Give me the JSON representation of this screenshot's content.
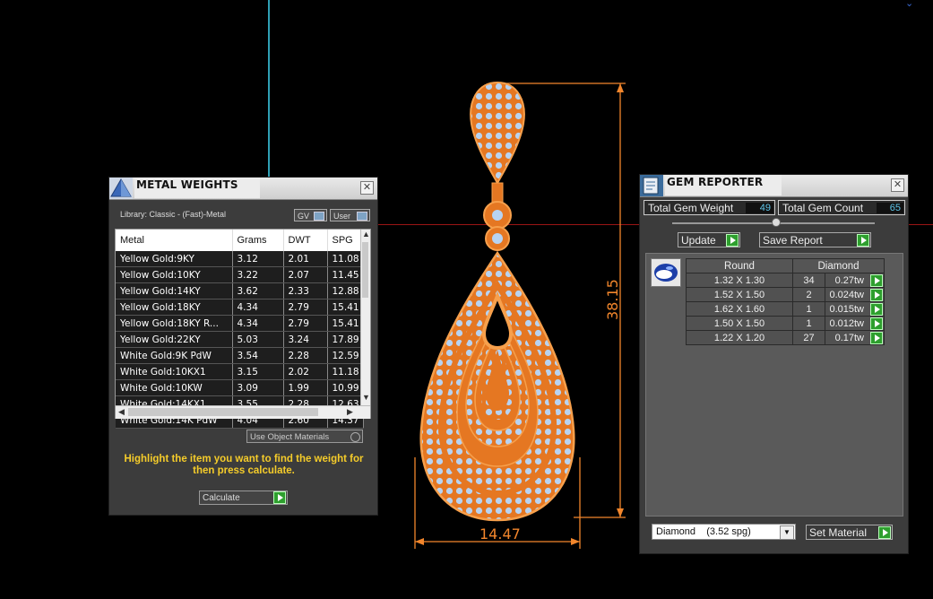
{
  "viewport": {
    "dim_height": "38.15",
    "dim_width": "14.47",
    "colors": {
      "accent_orange": "#f2862c",
      "gem_blue": "#b7d3f2",
      "guide_cyan": "#2f9fb4",
      "guide_red": "#9a1515"
    }
  },
  "metal_weights": {
    "title": "METAL WEIGHTS",
    "library": "Library: Classic - (Fast)-Metal",
    "gv_label": "GV",
    "user_label": "User",
    "columns": [
      "Metal",
      "Grams",
      "DWT",
      "SPG"
    ],
    "rows": [
      [
        "Yellow Gold:9KY",
        "3.12",
        "2.01",
        "11.08"
      ],
      [
        "Yellow Gold:10KY",
        "3.22",
        "2.07",
        "11.45"
      ],
      [
        "Yellow Gold:14KY",
        "3.62",
        "2.33",
        "12.88"
      ],
      [
        "Yellow Gold:18KY",
        "4.34",
        "2.79",
        "15.41"
      ],
      [
        "Yellow Gold:18KY R...",
        "4.34",
        "2.79",
        "15.41"
      ],
      [
        "Yellow Gold:22KY",
        "5.03",
        "3.24",
        "17.89"
      ],
      [
        "White Gold:9K PdW",
        "3.54",
        "2.28",
        "12.59"
      ],
      [
        "White Gold:10KX1",
        "3.15",
        "2.02",
        "11.18"
      ],
      [
        "White Gold:10KW",
        "3.09",
        "1.99",
        "10.99"
      ],
      [
        "White Gold:14KX1",
        "3.55",
        "2.28",
        "12.63"
      ],
      [
        "White Gold:14K PdW",
        "4.04",
        "2.60",
        "14.37"
      ]
    ],
    "use_object_materials": "Use Object Materials",
    "hint": "Highlight the item you want to find the weight for then press calculate.",
    "calculate": "Calculate"
  },
  "gem_reporter": {
    "title": "GEM REPORTER",
    "total_weight_label": "Total Gem Weight",
    "total_weight_value": "49",
    "total_count_label": "Total Gem Count",
    "total_count_value": "65",
    "update": "Update",
    "save_report": "Save Report",
    "col_shape": "Round",
    "col_material": "Diamond",
    "gems": [
      {
        "size": "1.32 X 1.30",
        "count": "34",
        "weight": "0.27tw"
      },
      {
        "size": "1.52 X 1.50",
        "count": "2",
        "weight": "0.024tw"
      },
      {
        "size": "1.62 X 1.60",
        "count": "1",
        "weight": "0.015tw"
      },
      {
        "size": "1.50 X 1.50",
        "count": "1",
        "weight": "0.012tw"
      },
      {
        "size": "1.22 X 1.20",
        "count": "27",
        "weight": "0.17tw"
      }
    ],
    "material_select": "Diamond    (3.52 spg)",
    "set_material": "Set Material"
  }
}
